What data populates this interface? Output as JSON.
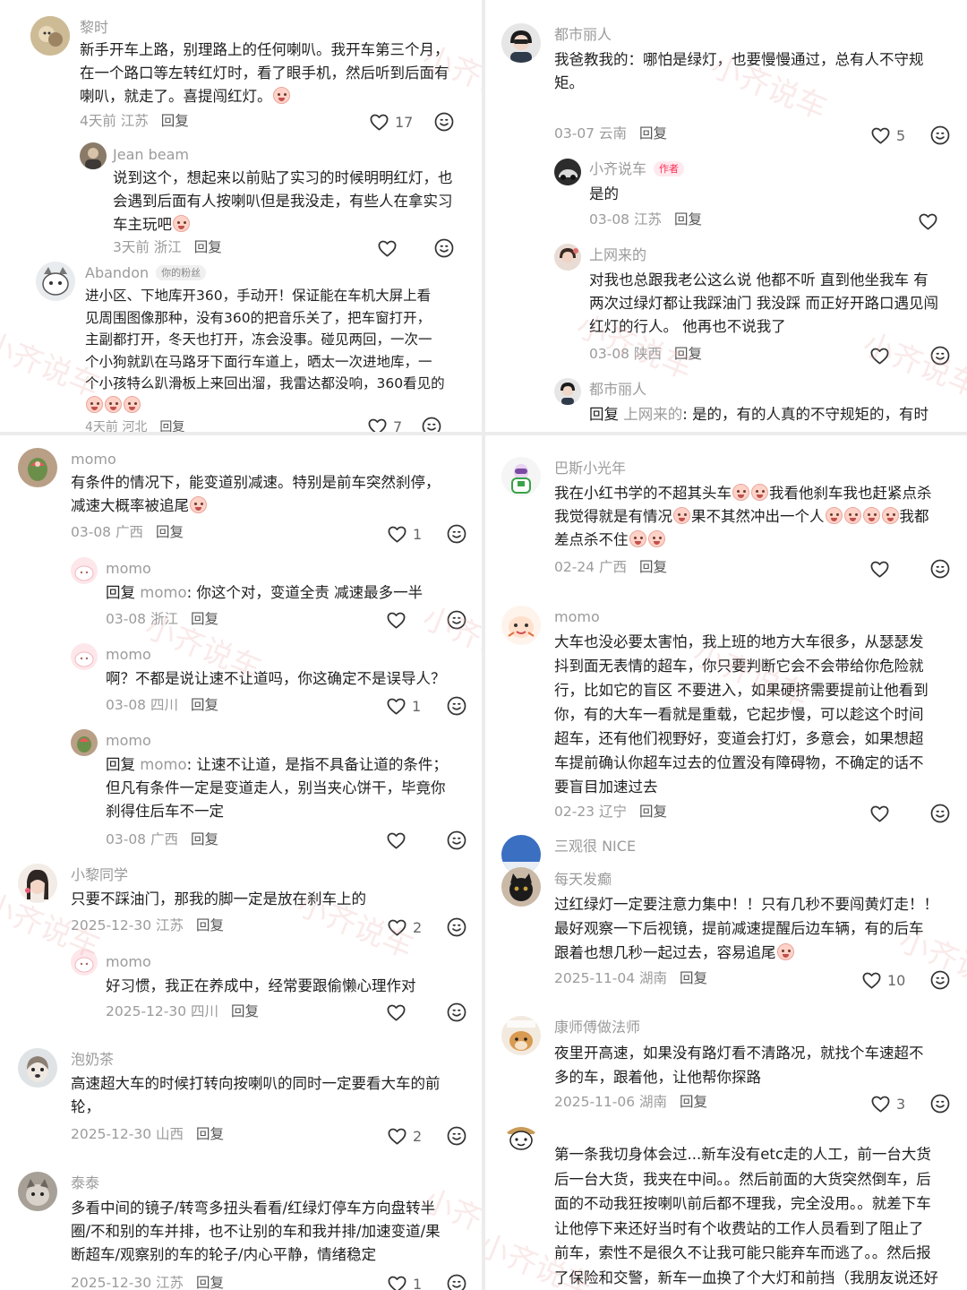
{
  "watermark": "小齐说车",
  "actions": {
    "reply": "回复"
  },
  "p1": {
    "c1": {
      "name": "黎时",
      "lines": [
        "新手开车上路，别理路上的任何喇叭。我开车第三个月，",
        "在一个路口等左转红灯时，看了眼手机，然后听到后面有",
        "喇叭，就走了。喜提闯红灯。"
      ],
      "meta": "4天前 江苏",
      "likes": "17"
    },
    "r1": {
      "name": "Jean beam",
      "lines": [
        "说到这个，想起来以前贴了实习的时候明明红灯，也",
        "会遇到后面有人按喇叭但是我没走，有些人在拿实习",
        "车主玩吧"
      ],
      "meta": "3天前 浙江"
    },
    "r2": {
      "name": "Abandon",
      "tag": "你的粉丝",
      "lines": [
        "进小区、下地库开360，手动开！保证能在车机大屏上看",
        "见周围图像那种，没有360的把音乐关了，把车窗打开，",
        "主副都打开，冬天也打开，冻会没事。碰见两回，一次一",
        "个小狗就趴在马路牙下面行车道上，晒太一次进地库，一",
        "个小孩特么趴滑板上来回出溜，我雷达都没响，360看见的"
      ],
      "meta": "4天前 河北",
      "likes": "7"
    }
  },
  "p2": {
    "c1": {
      "name": "momo",
      "lines": [
        "有条件的情况下，能变道别减速。特别是前车突然刹停，",
        "减速大概率被追尾"
      ],
      "meta": "03-08 广西",
      "likes": "1"
    },
    "r1": {
      "name": "momo",
      "prefix": "回复",
      "to": "momo",
      "text": ": 你这个对，变道全责 减速最多一半",
      "meta": "03-08 浙江"
    },
    "r2": {
      "name": "momo",
      "lines": [
        "啊？不都是说让速不让道吗，你这确定不是误导人？"
      ],
      "meta": "03-08 四川",
      "likes": "1"
    },
    "r3": {
      "name": "momo",
      "prefix": "回复",
      "to": "momo",
      "text": ": 让速不让道，是指不具备让道的条件；",
      "lines": [
        "但凡有条件一定是变道走人，别当夹心饼干，毕竟你",
        "刹得住后车不一定"
      ],
      "meta": "03-08 广西"
    },
    "c2": {
      "name": "小黎同学",
      "lines": [
        "只要不踩油门，那我的脚一定是放在刹车上的"
      ],
      "meta": "2025-12-30 江苏",
      "likes": "2"
    },
    "r4": {
      "name": "momo",
      "lines": [
        "好习惯，我正在养成中，经常要跟偷懒心理作对"
      ],
      "meta": "2025-12-30 四川"
    },
    "c3": {
      "name": "泡奶茶",
      "lines": [
        "高速超大车的时候打转向按喇叭的同时一定要看大车的前",
        "轮，"
      ],
      "meta": "2025-12-30 山西",
      "likes": "2"
    },
    "c4": {
      "name": "泰泰",
      "lines": [
        "多看中间的镜子/转弯多扭头看看/红绿灯停车方向盘转半",
        "圈/不和别的车并排，也不让别的车和我并排/加速变道/果",
        "断超车/观察别的车的轮子/内心平静，情绪稳定"
      ],
      "meta": "2025-12-30 江苏",
      "likes": "1"
    }
  },
  "p3": {
    "c1": {
      "name": "都市丽人",
      "lines": [
        "我爸教我的：哪怕是绿灯，也要慢慢通过，总有人不守规",
        "矩。"
      ],
      "meta": "03-07 云南",
      "likes": "5"
    },
    "r1": {
      "name": "小齐说车",
      "tag": "作者",
      "lines": [
        "是的"
      ],
      "meta": "03-08 江苏"
    },
    "r2": {
      "name": "上网来的",
      "lines": [
        "对我也总跟我老公这么说 他都不听 直到他坐我车 有",
        "两次过绿灯都让我踩油门 我没踩 而正好开路口遇见闯",
        "红灯的行人。  他再也不说我了"
      ],
      "meta": "03-08 陕西"
    },
    "r3": {
      "name": "都市丽人",
      "prefix": "回复",
      "to": "上网来的",
      "text": ": 是的，有的人真的不守规矩的，有时"
    }
  },
  "p4": {
    "c1": {
      "name": "巴斯小光年",
      "lines": [
        "我在小红书学的不超其头车",
        "我看他刹车我也赶紧点杀",
        "我觉得就是有情况",
        "果不其然冲出一个人",
        "我都",
        "差点杀不住"
      ],
      "meta": "02-24 广西"
    },
    "c2": {
      "name": "momo",
      "lines": [
        "大车也没必要太害怕，我上班的地方大车很多，从瑟瑟发",
        "抖到面无表情的超车，你只要判断它会不会带给你危险就",
        "行，比如它的盲区 不要进入，如果硬挤需要提前让他看到",
        "你，有的大车一看就是重载，它起步慢，可以趁这个时间",
        "超车，还有他们视野好，变道会打灯，多意会，如果想超",
        "车提前确认你超车过去的位置没有障碍物，不确定的话不",
        "要盲目加速过去"
      ],
      "meta": "02-23 辽宁"
    },
    "c3": {
      "name": "三观很 NICE"
    },
    "c4": {
      "name": "每天发癫",
      "lines": [
        "过红绿灯一定要注意力集中！！只有几秒不要闯黄灯走！！",
        "最好观察一下后视镜，提前减速提醒后边车辆，有的后车",
        "跟着也想几秒一起过去，容易追尾"
      ],
      "meta": "2025-11-04 湖南",
      "likes": "10"
    },
    "c5": {
      "name": "康师傅做法师",
      "lines": [
        "夜里开高速，如果没有路灯看不清路况，就找个车速超不",
        "多的车，跟着他，让他帮你探路"
      ],
      "meta": "2025-11-06 湖南",
      "likes": "3"
    },
    "c6": {
      "lines": [
        "第一条我切身体会过...新车没有etc走的人工，前一台大货",
        "后一台大货，我夹在中间。。然后前面的大货突然倒车，后",
        "面的不动我狂按喇叭前后都不理我，完全没用。。就差下车",
        "让他停下来还好当时有个收费站的工作人员看到了阻止了",
        "前车，索性不是很久不让我可能只能弃车而逃了。。然后报",
        "了保险和交警，新车一血换了个大灯和前挡（我朋友说还好"
      ]
    }
  }
}
